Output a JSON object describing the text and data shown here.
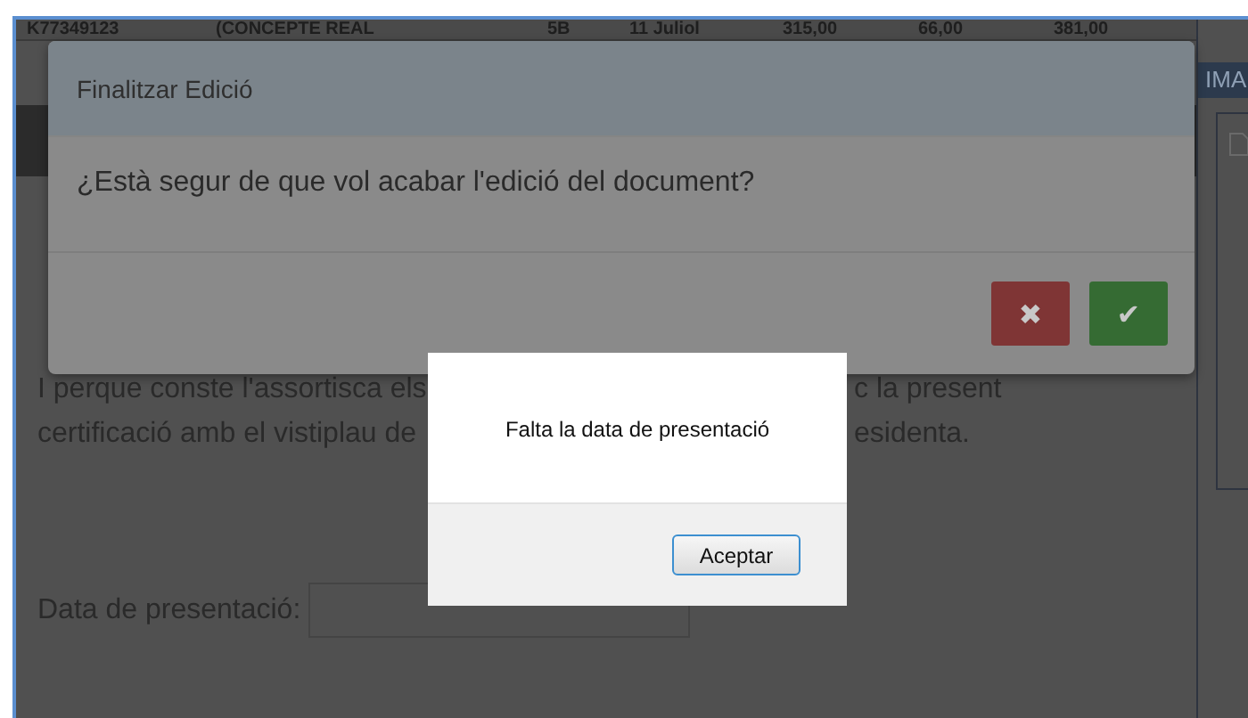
{
  "table_row": [
    "K77349123",
    "(CONCEPTE REAL",
    "5B",
    "11 Juliol",
    "315,00",
    "66,00",
    "381,00"
  ],
  "side_panel": {
    "title": "IMA"
  },
  "paragraph_lines": [
    {
      "left": "I perque conste l'assortisca els",
      "right": "c la present"
    },
    {
      "left": "certificació amb el vistiplau de",
      "right": "esidenta."
    }
  ],
  "date_field": {
    "label": "Data de presentació:"
  },
  "confirm_dialog": {
    "title": "Finalitzar Edició",
    "message": "¿Està segur de que vol acabar l'edició del document?",
    "buttons": [
      {
        "kind": "cancel",
        "icon": "✖"
      },
      {
        "kind": "ok",
        "icon": "✔"
      }
    ]
  },
  "alert": {
    "message": "Falta la data de presentació",
    "button": "Aceptar"
  }
}
